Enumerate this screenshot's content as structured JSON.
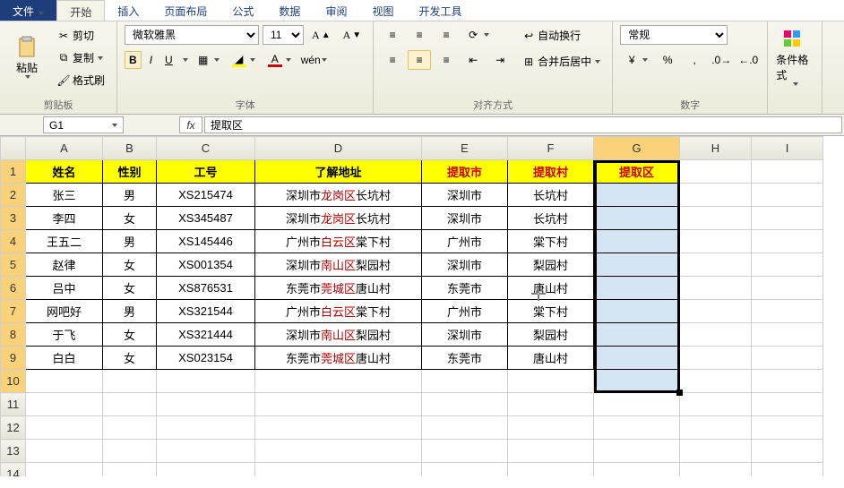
{
  "tabs": {
    "file": "文件",
    "home": "开始",
    "insert": "插入",
    "layout": "页面布局",
    "formulas": "公式",
    "data": "数据",
    "review": "审阅",
    "view": "视图",
    "dev": "开发工具"
  },
  "ribbon": {
    "clipboard": {
      "label": "剪贴板",
      "paste": "粘贴",
      "cut": "剪切",
      "copy": "复制",
      "fmtpainter": "格式刷"
    },
    "font": {
      "label": "字体",
      "family": "微软雅黑",
      "size": "11",
      "bold": "B",
      "italic": "I",
      "underline": "U"
    },
    "align": {
      "label": "对齐方式",
      "wrap": "自动换行",
      "merge": "合并后居中"
    },
    "number": {
      "label": "数字",
      "format": "常规"
    },
    "cond": {
      "label": "条件格式"
    }
  },
  "fbar": {
    "name": "G1",
    "fx": "fx",
    "formula": "提取区"
  },
  "columns": [
    "A",
    "B",
    "C",
    "D",
    "E",
    "F",
    "G",
    "H",
    "I"
  ],
  "headers": {
    "A": "姓名",
    "B": "性别",
    "C": "工号",
    "D": "了解地址",
    "E": "提取市",
    "F": "提取村",
    "G": "提取区"
  },
  "rows": [
    {
      "n": "张三",
      "g": "男",
      "id": "XS215474",
      "city": "深圳市",
      "dist": "龙岗区",
      "vil": "长坑村"
    },
    {
      "n": "李四",
      "g": "女",
      "id": "XS345487",
      "city": "深圳市",
      "dist": "龙岗区",
      "vil": "长坑村"
    },
    {
      "n": "王五二",
      "g": "男",
      "id": "XS145446",
      "city": "广州市",
      "dist": "白云区",
      "vil": "棠下村"
    },
    {
      "n": "赵律",
      "g": "女",
      "id": "XS001354",
      "city": "深圳市",
      "dist": "南山区",
      "vil": "梨园村"
    },
    {
      "n": "吕中",
      "g": "女",
      "id": "XS876531",
      "city": "东莞市",
      "dist": "莞城区",
      "vil": "唐山村"
    },
    {
      "n": "网吧好",
      "g": "男",
      "id": "XS321544",
      "city": "广州市",
      "dist": "白云区",
      "vil": "棠下村"
    },
    {
      "n": "于飞",
      "g": "女",
      "id": "XS321444",
      "city": "深圳市",
      "dist": "南山区",
      "vil": "梨园村"
    },
    {
      "n": "白白",
      "g": "女",
      "id": "XS023154",
      "city": "东莞市",
      "dist": "莞城区",
      "vil": "唐山村"
    }
  ],
  "selection": {
    "col": "G",
    "startRow": 1,
    "endRow": 10
  }
}
